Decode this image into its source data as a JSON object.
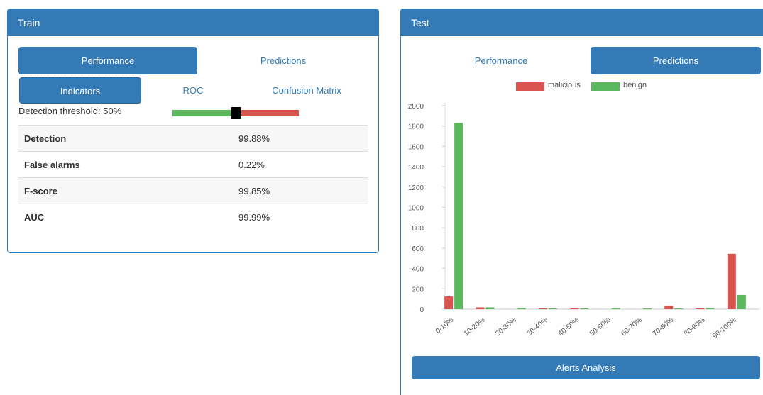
{
  "train": {
    "title": "Train",
    "tabs": [
      {
        "label": "Performance",
        "active": true
      },
      {
        "label": "Predictions",
        "active": false
      }
    ],
    "subtabs": [
      {
        "label": "Indicators",
        "active": true
      },
      {
        "label": "ROC",
        "active": false
      },
      {
        "label": "Confusion Matrix",
        "active": false
      }
    ],
    "threshold_label": "Detection threshold: 50%",
    "threshold_value": 0.5,
    "metrics": [
      {
        "name": "Detection",
        "value": "99.88%"
      },
      {
        "name": "False alarms",
        "value": "0.22%"
      },
      {
        "name": "F-score",
        "value": "99.85%"
      },
      {
        "name": "AUC",
        "value": "99.99%"
      }
    ]
  },
  "test": {
    "title": "Test",
    "tabs": [
      {
        "label": "Performance",
        "active": false
      },
      {
        "label": "Predictions",
        "active": true
      }
    ],
    "alerts_button": "Alerts Analysis"
  },
  "colors": {
    "primary": "#337ab7",
    "malicious": "#d9534f",
    "benign": "#5cb85c"
  },
  "chart_data": {
    "type": "bar",
    "categories": [
      "0-10%",
      "10-20%",
      "20-30%",
      "30-40%",
      "40-50%",
      "50-60%",
      "60-70%",
      "70-80%",
      "80-90%",
      "90-100%"
    ],
    "series": [
      {
        "name": "malicious",
        "values": [
          125,
          18,
          0,
          8,
          8,
          0,
          0,
          32,
          8,
          545
        ]
      },
      {
        "name": "benign",
        "values": [
          1830,
          18,
          12,
          8,
          8,
          12,
          8,
          8,
          12,
          140
        ]
      }
    ],
    "ylim": [
      0,
      2000
    ],
    "yticks": [
      0,
      200,
      400,
      600,
      800,
      1000,
      1200,
      1400,
      1600,
      1800,
      2000
    ],
    "legend": "top"
  }
}
